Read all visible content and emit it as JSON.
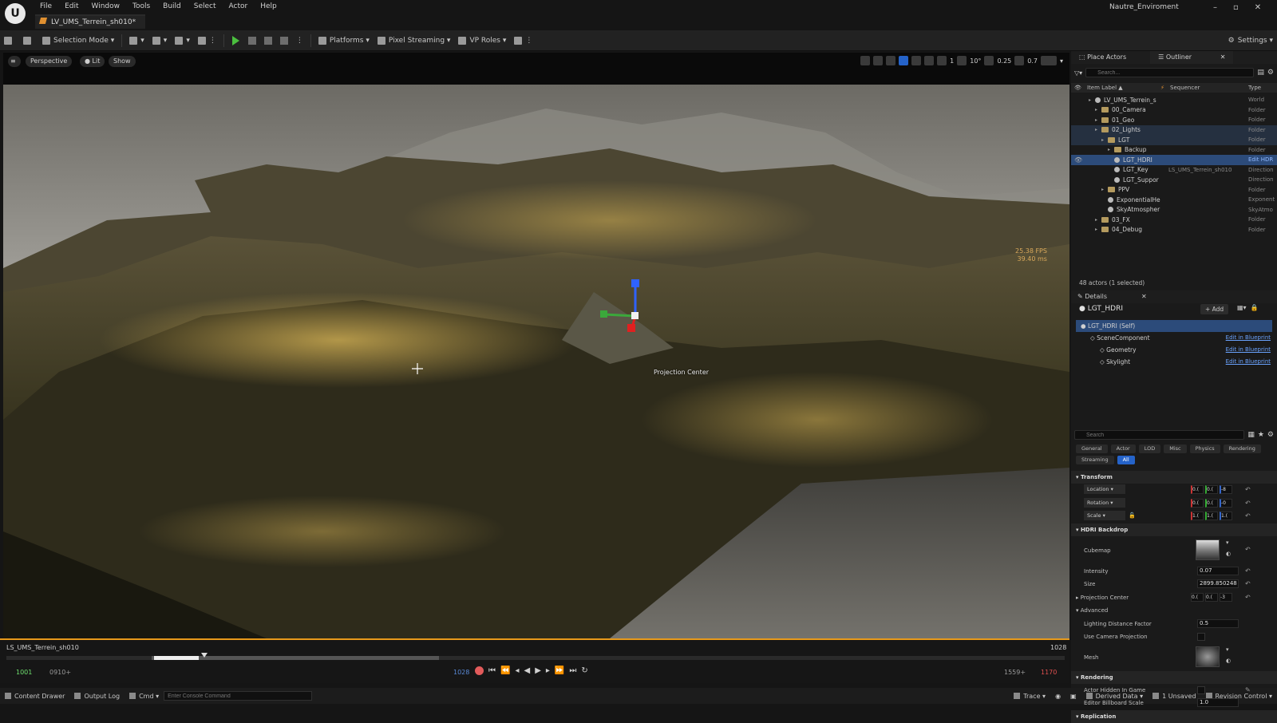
{
  "menu": [
    "File",
    "Edit",
    "Window",
    "Tools",
    "Build",
    "Select",
    "Actor",
    "Help"
  ],
  "doc_tab": "LV_UMS_Terrein_sh010*",
  "project_name": "Nautre_Enviroment",
  "toolbar": {
    "selection_mode": "Selection Mode",
    "platforms": "Platforms",
    "pixel_streaming": "Pixel Streaming",
    "vp_roles": "VP Roles",
    "settings": "Settings"
  },
  "viewport": {
    "perspective": "Perspective",
    "lit": "Lit",
    "show": "Show",
    "grid": "1",
    "angle": "10°",
    "scale": "0.25",
    "cam": "0.7",
    "fps": "25.38 FPS",
    "ms": "39.40 ms",
    "projection_label": "Projection Center"
  },
  "sequencer": {
    "name": "LS_UMS_Terrein_sh010",
    "end_frame": "1028",
    "start": "1001",
    "start2": "0910+",
    "current": "1028",
    "out": "1559+",
    "out2": "1170",
    "progress": 0.04
  },
  "statusbar": {
    "content_drawer": "Content Drawer",
    "output_log": "Output Log",
    "cmd": "Cmd",
    "cmd_placeholder": "Enter Console Command",
    "trace": "Trace",
    "derived_data": "Derived Data",
    "unsaved": "1 Unsaved",
    "revision": "Revision Control"
  },
  "outliner": {
    "tab_place": "Place Actors",
    "tab_outliner": "Outliner",
    "search_placeholder": "Search...",
    "col_label": "Item Label ▲",
    "col_seq": "Sequencer",
    "col_type": "Type",
    "rows": [
      {
        "label": "LV_UMS_Terrein_s",
        "type": "World",
        "indent": 1,
        "kind": "world"
      },
      {
        "label": "00_Camera",
        "type": "Folder",
        "indent": 2,
        "kind": "folder"
      },
      {
        "label": "01_Geo",
        "type": "Folder",
        "indent": 2,
        "kind": "folder"
      },
      {
        "label": "02_Lights",
        "type": "Folder",
        "indent": 2,
        "kind": "folder"
      },
      {
        "label": "LGT",
        "type": "Folder",
        "indent": 3,
        "kind": "folder"
      },
      {
        "label": "Backup",
        "type": "Folder",
        "indent": 4,
        "kind": "folder"
      },
      {
        "label": "LGT_HDRI",
        "type": "Edit HDR",
        "indent": 4,
        "kind": "actor",
        "sel": true
      },
      {
        "label": "LGT_Key",
        "type": "Direction",
        "indent": 4,
        "kind": "actor",
        "seq": "LS_UMS_Terrein_sh010"
      },
      {
        "label": "LGT_Suppor",
        "type": "Direction",
        "indent": 4,
        "kind": "actor"
      },
      {
        "label": "PPV",
        "type": "Folder",
        "indent": 3,
        "kind": "folder"
      },
      {
        "label": "ExponentialHe",
        "type": "Exponent",
        "indent": 3,
        "kind": "actor"
      },
      {
        "label": "SkyAtmospher",
        "type": "SkyAtmo",
        "indent": 3,
        "kind": "actor"
      },
      {
        "label": "03_FX",
        "type": "Folder",
        "indent": 2,
        "kind": "folder"
      },
      {
        "label": "04_Debug",
        "type": "Folder",
        "indent": 2,
        "kind": "folder"
      }
    ],
    "actor_count": "48 actors (1 selected)"
  },
  "details": {
    "tab": "Details",
    "actor": "LGT_HDRI",
    "add": "+ Add",
    "components": [
      {
        "label": "LGT_HDRI (Self)",
        "edit": "",
        "sel": true,
        "indent": 0
      },
      {
        "label": "SceneComponent",
        "edit": "Edit in Blueprint",
        "indent": 1
      },
      {
        "label": "Geometry",
        "edit": "Edit in Blueprint",
        "indent": 2
      },
      {
        "label": "Skylight",
        "edit": "Edit in Blueprint",
        "indent": 2
      }
    ],
    "search_placeholder": "Search",
    "filters": [
      "General",
      "Actor",
      "LOD",
      "Misc",
      "Physics",
      "Rendering",
      "Streaming",
      "All"
    ],
    "transform": "Transform",
    "location": "Location",
    "rotation": "Rotation",
    "scale": "Scale",
    "loc_vals": [
      "0.(",
      "0.(",
      "-8"
    ],
    "rot_vals": [
      "0.(",
      "0.(",
      "-0"
    ],
    "scale_vals": [
      "1.(",
      "1.(",
      "1.("
    ],
    "hdri": "HDRI Backdrop",
    "cubemap": "Cubemap",
    "intensity": "Intensity",
    "intensity_val": "0.07",
    "size": "Size",
    "size_val": "2899.850248",
    "proj_center": "Projection Center",
    "proj_vals": [
      "0.(",
      "0.(",
      "-3"
    ],
    "advanced": "Advanced",
    "ldf": "Lighting Distance Factor",
    "ldf_val": "0.5",
    "ucp": "Use Camera Projection",
    "mesh": "Mesh",
    "rendering": "Rendering",
    "hidden": "Actor Hidden In Game",
    "billboard": "Editor Billboard Scale",
    "billboard_val": "1.0",
    "replication": "Replication"
  }
}
